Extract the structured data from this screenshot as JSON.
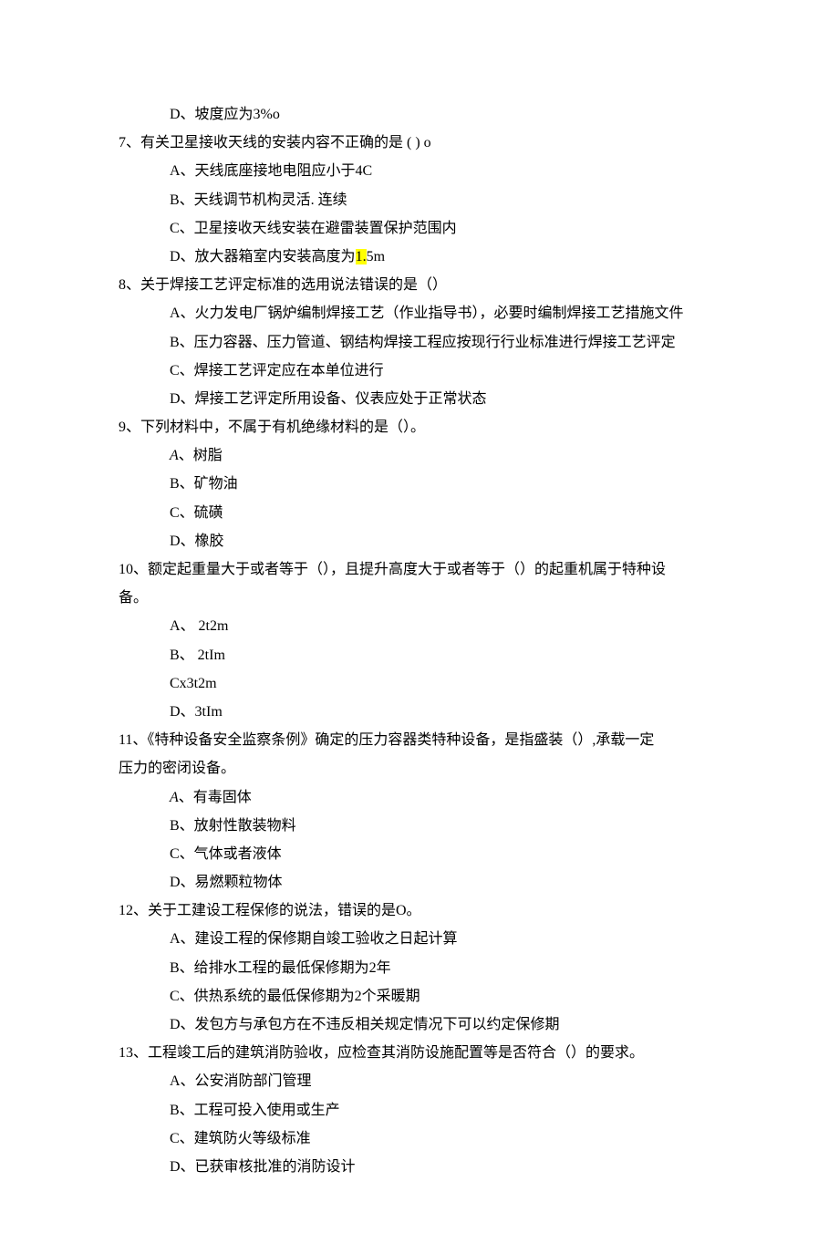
{
  "lines": [
    {
      "cls": "option",
      "text": "D、坡度应为3%o"
    },
    {
      "cls": "question",
      "text": "7、有关卫星接收天线的安装内容不正确的是 ( ) o"
    },
    {
      "cls": "option",
      "text": "A、天线底座接地电阻应小于4C"
    },
    {
      "cls": "option",
      "text": "B、天线调节机构灵活. 连续"
    },
    {
      "cls": "option",
      "text": "C、卫星接收天线安装在避雷装置保护范围内"
    },
    {
      "cls": "option",
      "parts": [
        {
          "t": "D、放大器箱室内安装高度为"
        },
        {
          "t": "1.",
          "hl": true
        },
        {
          "t": "5m"
        }
      ]
    },
    {
      "cls": "question",
      "text": "8、关于焊接工艺评定标准的选用说法错误的是（）"
    },
    {
      "cls": "option",
      "text": "A、火力发电厂锅炉编制焊接工艺（作业指导书），必要时编制焊接工艺措施文件"
    },
    {
      "cls": "option",
      "text": "B、压力容器、压力管道、钢结构焊接工程应按现行行业标准进行焊接工艺评定"
    },
    {
      "cls": "option",
      "text": "C、焊接工艺评定应在本单位进行"
    },
    {
      "cls": "option",
      "text": "D、焊接工艺评定所用设备、仪表应处于正常状态"
    },
    {
      "cls": "question",
      "text": "9、下列材料中，不属于有机绝缘材料的是（）。"
    },
    {
      "cls": "option",
      "parts": [
        {
          "t": "A",
          "it": true
        },
        {
          "t": "、树脂"
        }
      ]
    },
    {
      "cls": "option",
      "text": "B、矿物油"
    },
    {
      "cls": "option",
      "text": "C、硫磺"
    },
    {
      "cls": "option",
      "text": "D、橡胶"
    },
    {
      "cls": "question",
      "text": "10、额定起重量大于或者等于（），且提升高度大于或者等于（）的起重机属于特种设"
    },
    {
      "cls": "cont",
      "text": "备。"
    },
    {
      "cls": "option",
      "text": "A、 2t2m"
    },
    {
      "cls": "option",
      "text": "B、 2tIm"
    },
    {
      "cls": "option",
      "text": "Cx3t2m"
    },
    {
      "cls": "option",
      "text": "D、3tIm"
    },
    {
      "cls": "question",
      "text": "11、《特种设备安全监察条例》确定的压力容器类特种设备，是指盛装（）,承载一定"
    },
    {
      "cls": "cont",
      "text": "压力的密闭设备。"
    },
    {
      "cls": "option",
      "parts": [
        {
          "t": "A",
          "it": true
        },
        {
          "t": "、有毒固体"
        }
      ]
    },
    {
      "cls": "option",
      "text": "B、放射性散装物料"
    },
    {
      "cls": "option",
      "text": "C、气体或者液体"
    },
    {
      "cls": "option",
      "text": "D、易燃颗粒物体"
    },
    {
      "cls": "question",
      "text": "12、关于工建设工程保修的说法，错误的是O。"
    },
    {
      "cls": "option",
      "text": "A、建设工程的保修期自竣工验收之日起计算"
    },
    {
      "cls": "option",
      "text": "B、给排水工程的最低保修期为2年"
    },
    {
      "cls": "option",
      "text": "C、供热系统的最低保修期为2个采暖期"
    },
    {
      "cls": "option",
      "text": "D、发包方与承包方在不违反相关规定情况下可以约定保修期"
    },
    {
      "cls": "question",
      "text": "13、工程竣工后的建筑消防验收，应检查其消防设施配置等是否符合（）的要求。"
    },
    {
      "cls": "option",
      "text": "A、公安消防部门管理"
    },
    {
      "cls": "option",
      "text": "B、工程可投入使用或生产"
    },
    {
      "cls": "option",
      "text": "C、建筑防火等级标准"
    },
    {
      "cls": "option",
      "text": "D、已获审核批准的消防设计"
    }
  ]
}
